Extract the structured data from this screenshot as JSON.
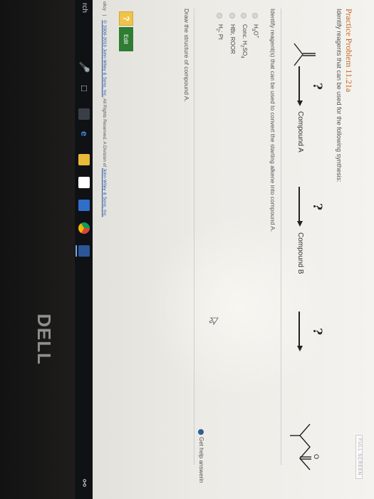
{
  "screen": {
    "fullscreen_label": "FULL SCREEN",
    "problem_title": "Practice Problem 11.21a",
    "problem_subtitle": "Identify reagents that can be used for the following synthesis:",
    "synthesis": {
      "question_mark": "?",
      "compound_a": "Compound A",
      "compound_b": "Compound B"
    },
    "question1": {
      "prompt": "Identify reagent(s) that can be used to convert the starting alkene into compound A.",
      "options": [
        {
          "base": "H",
          "sub": "3",
          "mid": "O",
          "sup": "+",
          "tail": ""
        },
        {
          "base": "Conc. H",
          "sub": "2",
          "mid": "SO",
          "sub2": "4",
          "tail": ""
        },
        {
          "base": "HBr, ROOR",
          "sub": "",
          "mid": "",
          "tail": ""
        },
        {
          "base": "H",
          "sub": "2",
          "mid": "; Pt",
          "tail": ""
        }
      ]
    },
    "get_help_label": "Get help answerin",
    "question2": {
      "prompt": "Draw the structure of compound A.",
      "help_box": "?",
      "edit_label": "Edit"
    },
    "footer": {
      "policy": "olicy",
      "separator": "|",
      "copyright_link": "© 2000-2019 John Wiley & Sons, Inc.",
      "rights": "All Rights Reserved. A Division of",
      "company_link": "John Wiley & Sons, Inc."
    }
  },
  "taskbar": {
    "search_text": "rch",
    "tray_icon": "people-icon"
  },
  "bezel": {
    "brand": "DELL"
  },
  "colors": {
    "title": "#c8631c",
    "link": "#2a55a5",
    "edit_button": "#2e7d32",
    "help_box": "#f0c34a"
  }
}
